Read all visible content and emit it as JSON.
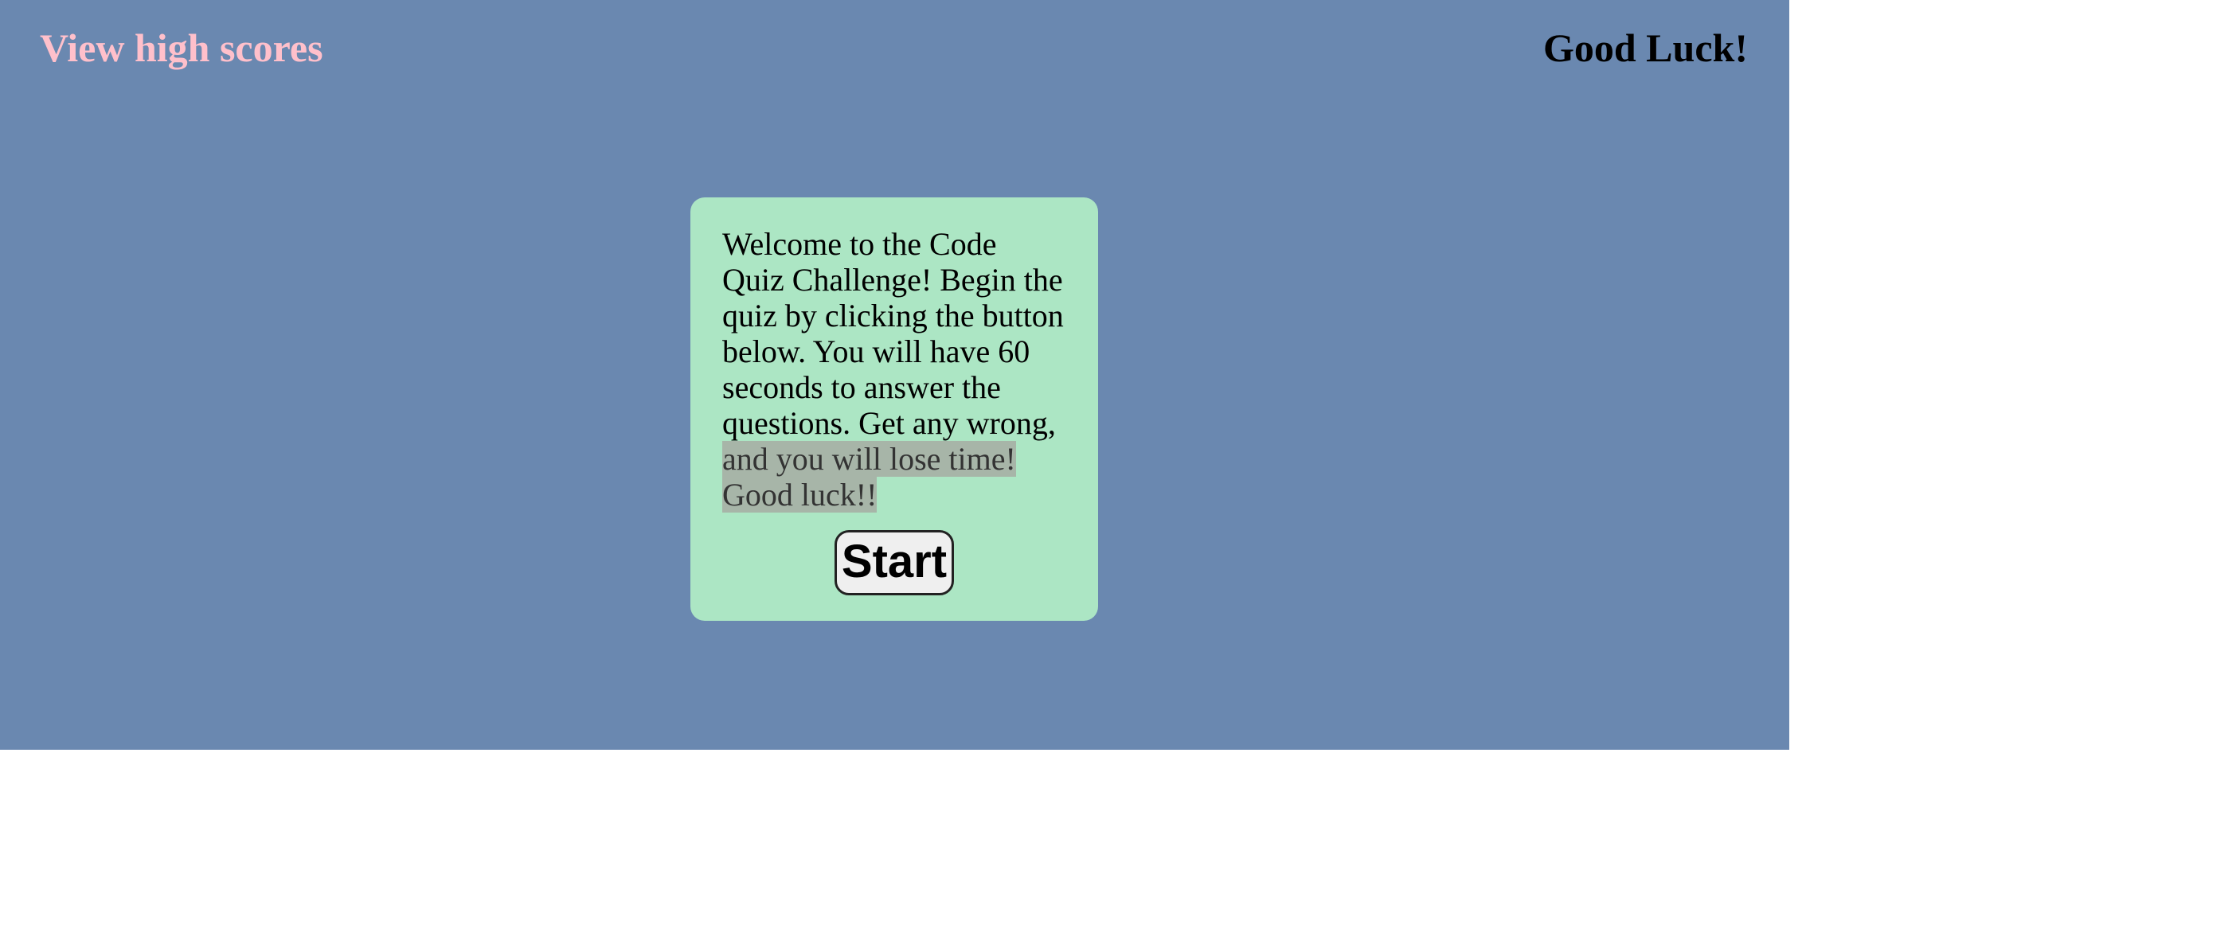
{
  "header": {
    "high_scores_link": "View high scores",
    "timer_text": "Good Luck!"
  },
  "intro_card": {
    "text_plain": "Welcome to the Code Quiz Challenge! Begin the quiz by clicking the button below. You will have 60 seconds to answer the questions. Get any wrong, ",
    "text_highlighted": "and you will lose time! Good luck!!",
    "start_button_label": "Start"
  },
  "colors": {
    "page_background": "#6a88b0",
    "high_scores_link": "#ffc0cb",
    "card_background": "#ace6c4",
    "text_highlight": "#a7b5a8",
    "button_background": "#efefef"
  }
}
